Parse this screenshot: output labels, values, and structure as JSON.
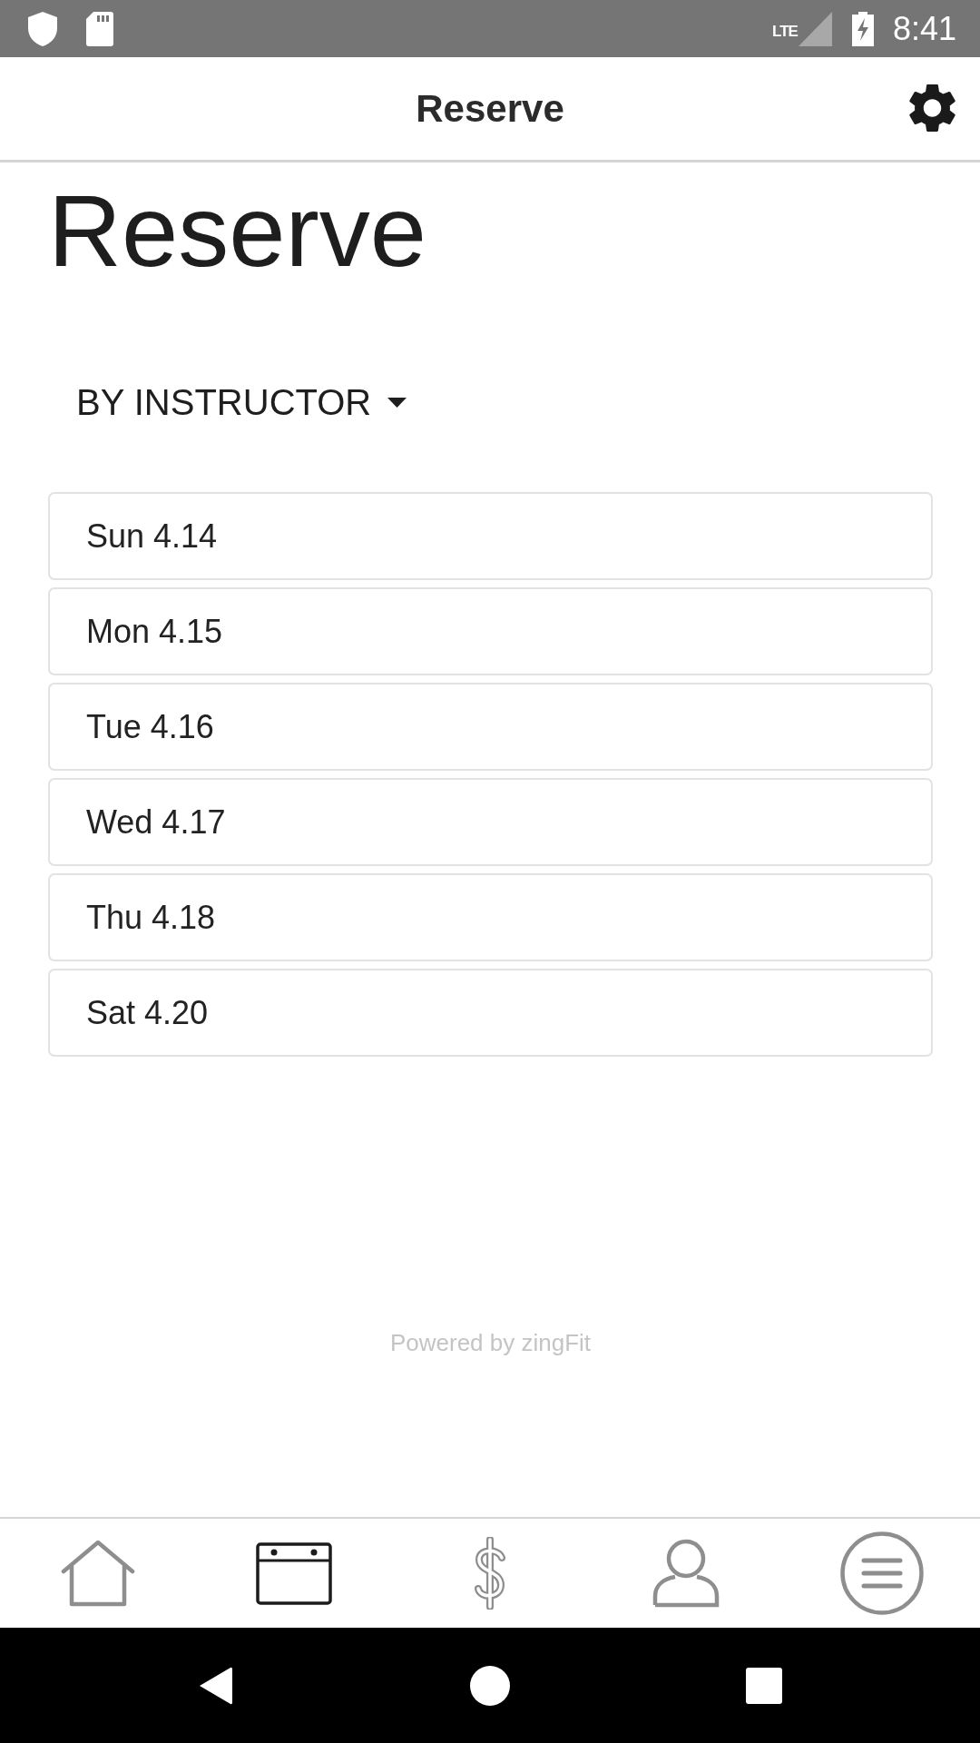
{
  "status_bar": {
    "network": "LTE",
    "time": "8:41"
  },
  "app_bar": {
    "title": "Reserve"
  },
  "page": {
    "heading": "Reserve",
    "filter": {
      "label": "BY INSTRUCTOR"
    },
    "dates": [
      "Sun 4.14",
      "Mon 4.15",
      "Tue 4.16",
      "Wed 4.17",
      "Thu 4.18",
      "Sat 4.20"
    ]
  },
  "footer": {
    "text": "Powered by zingFit"
  },
  "bottom_nav": [
    {
      "kind": "home",
      "selected": false
    },
    {
      "kind": "calendar",
      "selected": true
    },
    {
      "kind": "dollar",
      "selected": false
    },
    {
      "kind": "person",
      "selected": false
    },
    {
      "kind": "menu",
      "selected": false
    }
  ]
}
